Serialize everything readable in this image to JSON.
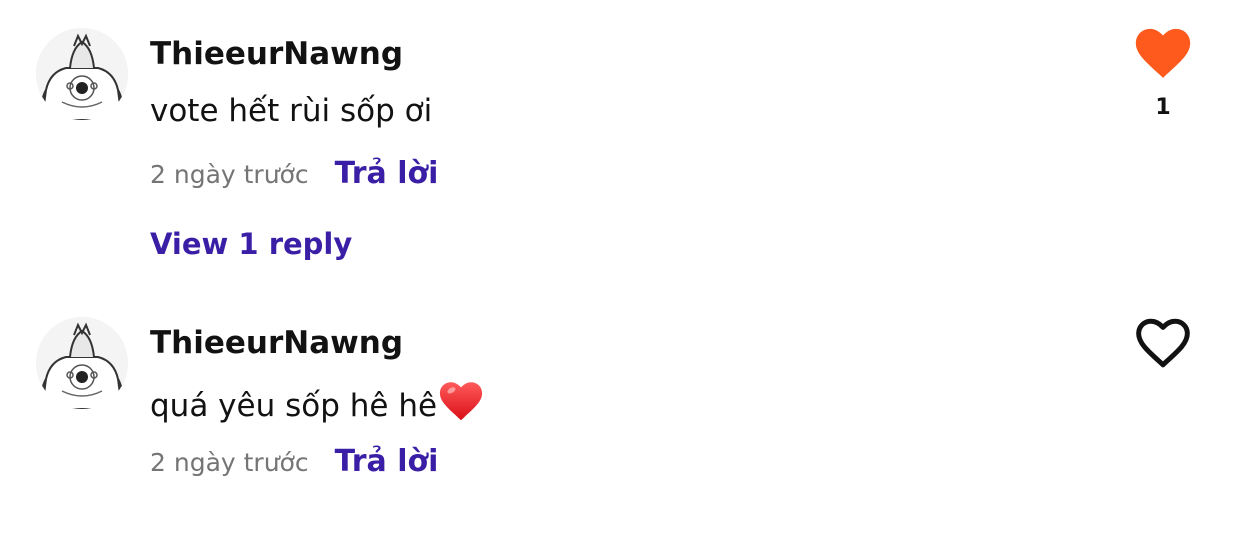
{
  "comments": [
    {
      "username": "ThieeurNawng",
      "text": "vote hết rùi sốp ơi",
      "time": "2 ngày trước",
      "reply_label": "Trả lời",
      "view_replies_label": "View 1 reply",
      "liked": true,
      "like_count": "1"
    },
    {
      "username": "ThieeurNawng",
      "text": "quá yêu sốp hê hê",
      "emoji": "red-heart-emoji",
      "time": "2 ngày trước",
      "reply_label": "Trả lời",
      "liked": false
    }
  ],
  "colors": {
    "like_active": "#fe5a1d",
    "link": "#3a1fa6",
    "meta": "#757575",
    "text": "#121212"
  }
}
